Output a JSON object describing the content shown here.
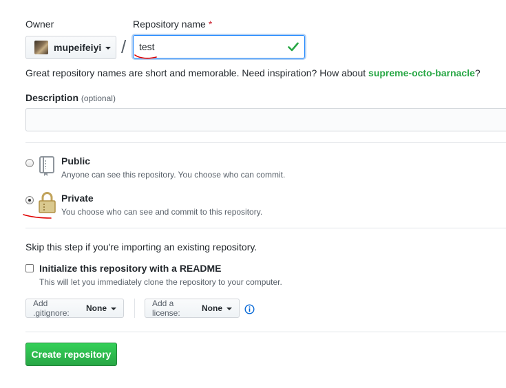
{
  "owner": {
    "label": "Owner",
    "value": "mupeifeiyi"
  },
  "repo_name": {
    "label": "Repository name",
    "required_mark": "*",
    "value": "test"
  },
  "hint": {
    "text": "Great repository names are short and memorable. Need inspiration? How about ",
    "suggestion": "supreme-octo-barnacle",
    "end": "?"
  },
  "description": {
    "label": "Description",
    "optional": "(optional)",
    "value": ""
  },
  "visibility": {
    "selected": "private",
    "public": {
      "title": "Public",
      "desc": "Anyone can see this repository. You choose who can commit."
    },
    "private": {
      "title": "Private",
      "desc": "You choose who can see and commit to this repository."
    }
  },
  "init": {
    "skip_text": "Skip this step if you're importing an existing repository.",
    "readme_label": "Initialize this repository with a README",
    "readme_desc": "This will let you immediately clone the repository to your computer.",
    "readme_checked": false
  },
  "gitignore": {
    "label": "Add .gitignore:",
    "value": "None"
  },
  "license": {
    "label": "Add a license:",
    "value": "None"
  },
  "create_button": "Create repository",
  "colors": {
    "accent_green": "#28a745",
    "annotation_red": "#e00000",
    "info_blue": "#0366d6"
  },
  "icons": [
    "caret-down-icon",
    "check-icon",
    "repo-icon",
    "lock-icon",
    "info-icon"
  ]
}
